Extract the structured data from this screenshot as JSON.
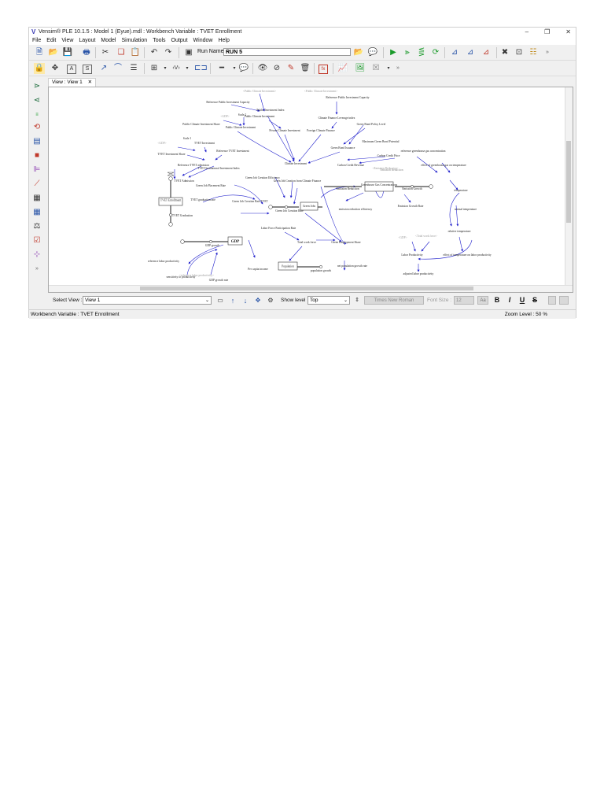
{
  "window": {
    "title": "Vensim® PLE 10.1.5 : Model 1 (Eyue).mdl : Workbench Variable : TVET Enrollment",
    "minimize": "–",
    "restore": "❐",
    "close": "✕"
  },
  "menu": [
    "File",
    "Edit",
    "View",
    "Layout",
    "Model",
    "Simulation",
    "Tools",
    "Output",
    "Window",
    "Help"
  ],
  "toolbar": {
    "run_name_label": "Run Name:",
    "run_name_value": "RUN 5"
  },
  "tab": {
    "label": "View : View 1",
    "close": "✕"
  },
  "bottom": {
    "select_view_label": "Select View :",
    "select_view_value": "View 1",
    "show_level_label": "Show level",
    "show_level_value": "Top",
    "font_name": "Times New Roman",
    "font_size_label": "Font Size :",
    "font_size_value": "12",
    "bold": "B",
    "italic": "I",
    "underline": "U",
    "strike": "S"
  },
  "status": {
    "left": "Workbench Variable : TVET Enrollment",
    "right": "Zoom Level : 50 %"
  },
  "diagram": {
    "stocks": [
      "TVET Enrollment",
      "Green Jobs",
      "Greenhouse Gas Concentrations",
      "GDP",
      "Population"
    ],
    "variables": [
      "Public Climate Investment",
      "Reference Public Investment Capacity",
      "Public Investment Index",
      "Climate Finance Leverage index",
      "Reference Public Investment Capacity",
      "Public Climate Investment Share",
      "Scale 2",
      "Public Climate Investment",
      "Private Climate Investment",
      "Foreign Climate Finance",
      "Green Bond Policy Level",
      "Green Bond Issuance",
      "Maximum Green Bond Potential",
      "Carbon Credit Revenue",
      "Carbon Credit Price",
      "Emission Reduction",
      "reference greenhouse gas concentration",
      "effect of greenhouse gas on temperature",
      "Climate Investment",
      "Scale 1",
      "TVET Investment",
      "Reference TVET Investment",
      "TVET Investment Share",
      "Reference TVET admission",
      "TVET Institutional Investment Index",
      "TVET Admission",
      "TVET graduation rate",
      "TVET Graduation",
      "Green Job Placement Rate",
      "Green Job Creation Rate TVET",
      "Green Job Creation Efficiency",
      "Green Job Creation from Climate Finance",
      "Green Job Creation Rate",
      "Emission Reduction",
      "emission reduction efficiency",
      "Emission Growth",
      "Emission Growth Rate",
      "temperature",
      "normal temperature",
      "relative temperature",
      "effect of temperature on labor productivity",
      "Labor Productivity",
      "adjusted labor productivity",
      "Labor Force Participation Rate",
      "Total work force",
      "Green Employment Share",
      "GDP growth",
      "reference labor productivity",
      "sensitivity to productivity",
      "GDP growth rate",
      "Per capita income",
      "population growth",
      "net population growth rate"
    ],
    "ghosts": [
      "<GDP>",
      "<GDP>",
      "<Public Climate Investment>",
      "<Public Climate Investment>",
      "<Emission Reduction>",
      "<GDP>",
      "<Total work force>",
      "<reference labor productivity>"
    ]
  }
}
